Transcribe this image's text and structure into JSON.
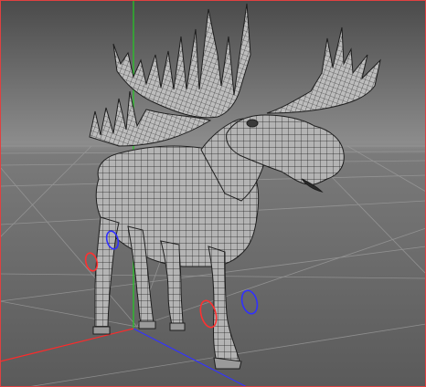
{
  "viewport": {
    "kind": "3d-perspective-viewport",
    "shading": "wireframe-on-shaded",
    "subject": "moose-mesh",
    "colors": {
      "background_top": "#4a4a4a",
      "background_horizon": "#8c8c8c",
      "background_bottom": "#5a5a5a",
      "grid_line": "#9e9e9e",
      "mesh_fill": "#b4b4b4",
      "mesh_wire": "#1e1e1e",
      "axis_x": "#ff2a2a",
      "axis_y": "#22cc22",
      "axis_z": "#3333ff",
      "frame_border": "#e04040",
      "ik_handle_left": "#ff3030",
      "ik_handle_right": "#3030ff"
    },
    "icons": {
      "axes": "world-axes-icon",
      "ik_handles": "ik-handle-ring-icon"
    }
  }
}
